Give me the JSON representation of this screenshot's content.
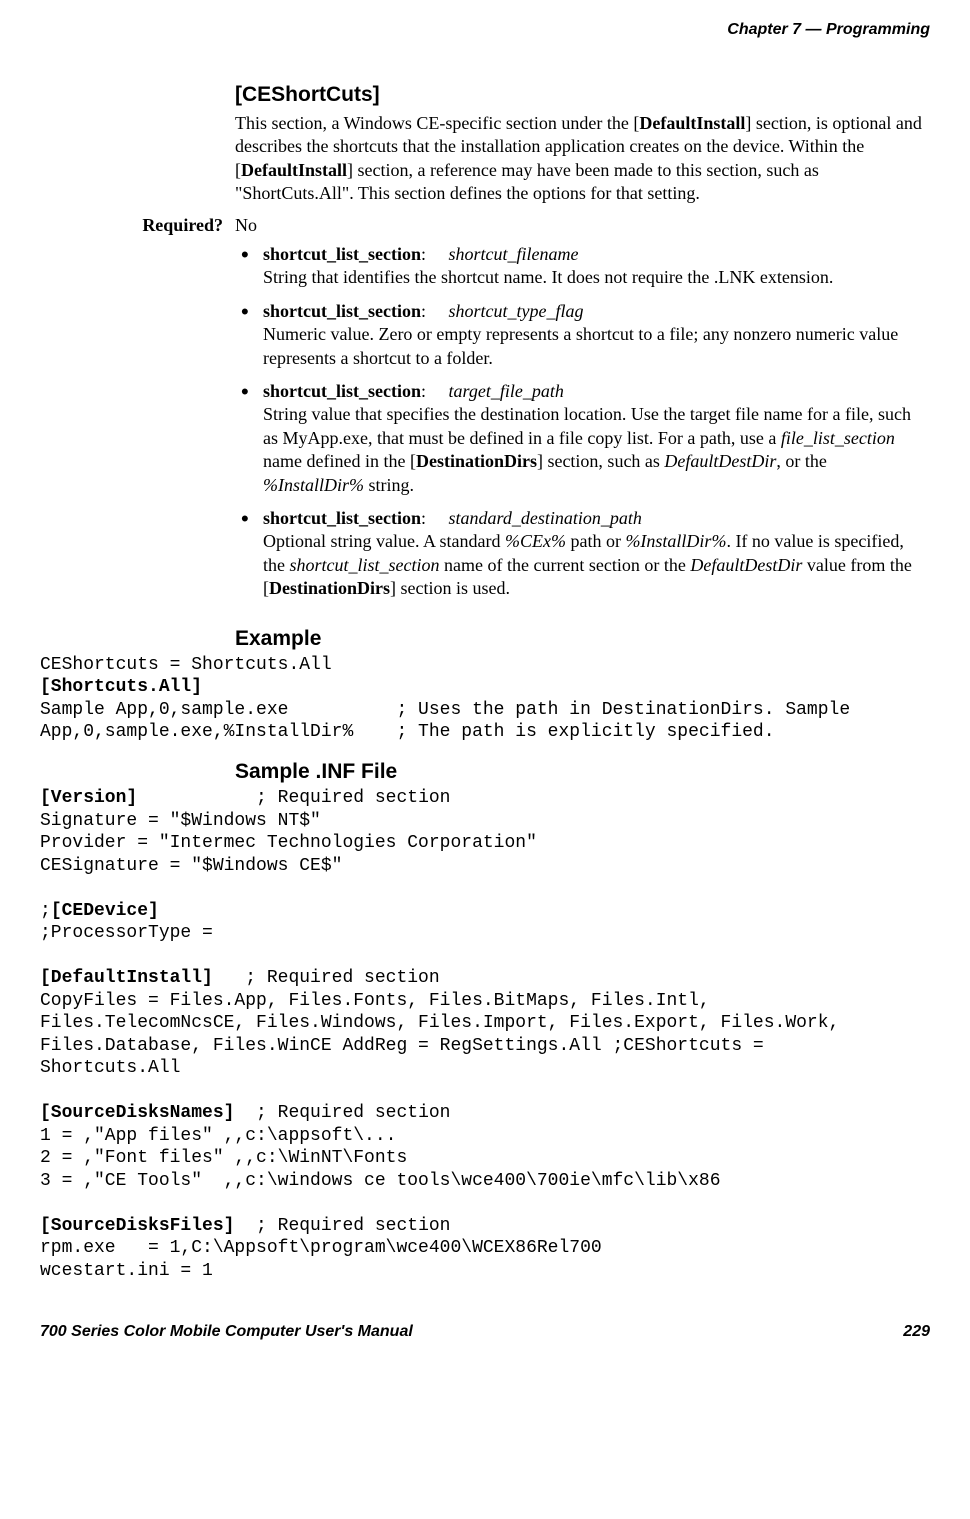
{
  "header": {
    "chapter_label": "Chapter",
    "chapter_num": "7",
    "dash": "—",
    "chapter_title": "Programming"
  },
  "ceshortcuts": {
    "heading": "[CEShortCuts]",
    "para_parts": {
      "p1": "This section, a Windows CE-specific section under the [",
      "b1": "DefaultInstall",
      "p2": "] section, is optional and describes the shortcuts that the installation application creates on the device. Within the [",
      "b2": "DefaultInstall",
      "p3": "] section, a reference may have been made to this section, such as \"ShortCuts.All\". This section defines the options for that setting."
    },
    "required_label": "Required?",
    "required_value": "No",
    "bullets": [
      {
        "label": "shortcut_list_section",
        "colon": ":",
        "param": "shortcut_filename",
        "desc_pre": "String that identifies the shortcut name. It does not require the .LNK extension."
      },
      {
        "label": "shortcut_list_section",
        "colon": ":",
        "param": "shortcut_type_flag",
        "desc_pre": "Numeric value. Zero or empty represents a shortcut to a file; any nonzero numeric value represents a shortcut to a folder."
      },
      {
        "label": "shortcut_list_section",
        "colon": ":",
        "param": "target_file_path",
        "desc_html_parts": {
          "t0": "String value that specifies the destination location. Use the target file name for a file, such as MyApp.exe, that must be defined in a file copy list. For a path, use a ",
          "i1": "file_list_section",
          "t1": " name defined in the [",
          "b1": "DestinationDirs",
          "t2": "] section, such as ",
          "i2": "DefaultDestDir",
          "t3": ", or the ",
          "i3": "%InstallDir%",
          "t4": " string."
        }
      },
      {
        "label": "shortcut_list_section",
        "colon": ":",
        "param": "standard_destination_path",
        "desc_html_parts": {
          "t0": "Optional string value. A standard ",
          "i1": "%CEx%",
          "t1": " path or ",
          "i2": "%InstallDir%",
          "t2": ". If no value is specified, the ",
          "i3": "shortcut_list_section",
          "t3": " name of the current section or the ",
          "i4": "DefaultDestDir",
          "t4": " value from the [",
          "b1": "DestinationDirs",
          "t5": "] section is used."
        }
      }
    ]
  },
  "example": {
    "heading": "Example",
    "code_parts": {
      "l1": "CEShortcuts = Shortcuts.All",
      "l2b": "[Shortcuts.All]",
      "l3": "Sample App,0,sample.exe          ; Uses the path in DestinationDirs. Sample",
      "l4": "App,0,sample.exe,%InstallDir%    ; The path is explicitly specified."
    }
  },
  "sample_inf": {
    "heading": "Sample .INF File",
    "code_parts": {
      "s1b": "[Version]",
      "s1r": "           ; Required section",
      "s2": "Signature = \"$Windows NT$\"",
      "s3": "Provider = \"Intermec Technologies Corporation\"",
      "s4": "CESignature = \"$Windows CE$\"",
      "blank1": "",
      "s5a": ";",
      "s5b": "[CEDevice]",
      "s6": ";ProcessorType =",
      "blank2": "",
      "s7b": "[DefaultInstall]",
      "s7r": "   ; Required section",
      "s8": "CopyFiles = Files.App, Files.Fonts, Files.BitMaps, Files.Intl,",
      "s9": "Files.TelecomNcsCE, Files.Windows, Files.Import, Files.Export, Files.Work,",
      "s10": "Files.Database, Files.WinCE AddReg = RegSettings.All ;CEShortcuts =",
      "s11": "Shortcuts.All",
      "blank3": "",
      "s12b": "[SourceDisksNames]",
      "s12r": "  ; Required section",
      "s13": "1 = ,\"App files\" ,,c:\\appsoft\\...",
      "s14": "2 = ,\"Font files\" ,,c:\\WinNT\\Fonts",
      "s15": "3 = ,\"CE Tools\"  ,,c:\\windows ce tools\\wce400\\700ie\\mfc\\lib\\x86",
      "blank4": "",
      "s16b": "[SourceDisksFiles]",
      "s16r": "  ; Required section",
      "s17": "rpm.exe   = 1,C:\\Appsoft\\program\\wce400\\WCEX86Rel700",
      "s18": "wcestart.ini = 1"
    }
  },
  "footer": {
    "left": "700 Series Color Mobile Computer User's Manual",
    "right": "229"
  }
}
